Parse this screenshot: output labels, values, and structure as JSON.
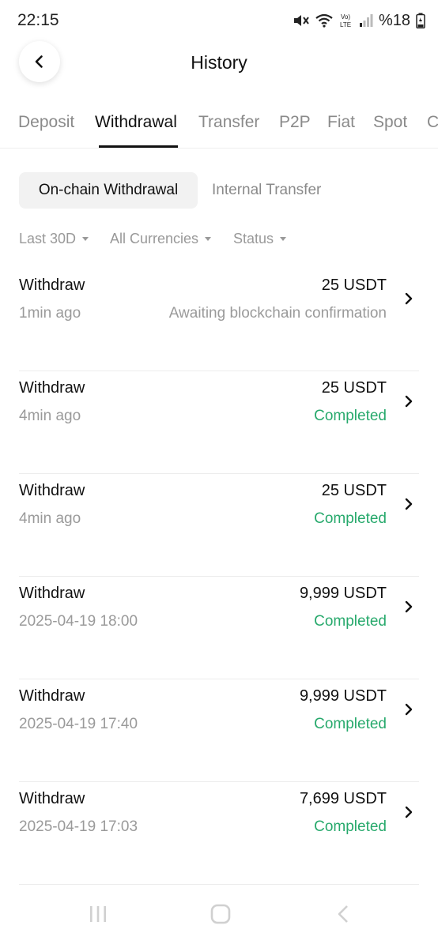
{
  "status_bar": {
    "time": "22:15",
    "battery": "%18",
    "icons": [
      "mute-icon",
      "wifi-icon",
      "volte-icon",
      "signal-icon",
      "battery-icon"
    ]
  },
  "header": {
    "title": "History",
    "back_icon": "chevron-left-icon"
  },
  "main_tabs": [
    {
      "label": "Deposit",
      "active": false
    },
    {
      "label": "Withdrawal",
      "active": true
    },
    {
      "label": "Transfer",
      "active": false
    },
    {
      "label": "P2P",
      "active": false
    },
    {
      "label": "Fiat",
      "active": false
    },
    {
      "label": "Spot",
      "active": false
    },
    {
      "label": "C",
      "active": false
    }
  ],
  "sub_tabs": [
    {
      "label": "On-chain Withdrawal",
      "active": true
    },
    {
      "label": "Internal Transfer",
      "active": false
    }
  ],
  "filters": [
    {
      "label": "Last 30D"
    },
    {
      "label": "All Currencies"
    },
    {
      "label": "Status"
    }
  ],
  "colors": {
    "completed": "#27a96c",
    "muted": "#9a9a9a",
    "text": "#111111"
  },
  "rows": [
    {
      "type": "Withdraw",
      "time": "1min ago",
      "amount": "25 USDT",
      "status": "Awaiting blockchain confirmation",
      "state": "pending"
    },
    {
      "type": "Withdraw",
      "time": "4min ago",
      "amount": "25 USDT",
      "status": "Completed",
      "state": "completed"
    },
    {
      "type": "Withdraw",
      "time": "4min ago",
      "amount": "25 USDT",
      "status": "Completed",
      "state": "completed"
    },
    {
      "type": "Withdraw",
      "time": "2025-04-19 18:00",
      "amount": "9,999 USDT",
      "status": "Completed",
      "state": "completed"
    },
    {
      "type": "Withdraw",
      "time": "2025-04-19 17:40",
      "amount": "9,999 USDT",
      "status": "Completed",
      "state": "completed"
    },
    {
      "type": "Withdraw",
      "time": "2025-04-19 17:03",
      "amount": "7,699 USDT",
      "status": "Completed",
      "state": "completed"
    }
  ],
  "nav_bar": [
    "recent-apps-icon",
    "home-icon",
    "back-icon"
  ]
}
